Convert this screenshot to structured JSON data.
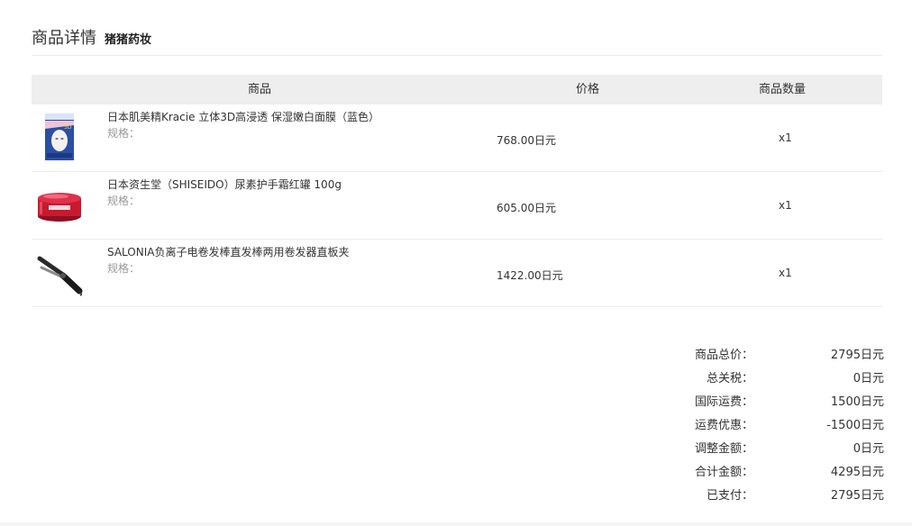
{
  "header": {
    "title": "商品详情",
    "shop_name": "猪猪药妆"
  },
  "table": {
    "columns": {
      "product": "商品",
      "price": "价格",
      "quantity": "商品数量"
    },
    "rows": [
      {
        "name": "日本肌美精Kracie 立体3D高浸透 保湿嫩白面膜（蓝色）",
        "spec_label": "规格：",
        "price": "768.00日元",
        "quantity": "x1",
        "thumbnail_icon": "face-mask-product-image"
      },
      {
        "name": "日本资生堂（SHISEIDO）尿素护手霜红罐 100g",
        "spec_label": "规格：",
        "price": "605.00日元",
        "quantity": "x1",
        "thumbnail_icon": "hand-cream-jar-product-image"
      },
      {
        "name": "SALONIA负离子电卷发棒直发棒两用卷发器直板夹",
        "spec_label": "规格：",
        "price": "1422.00日元",
        "quantity": "x1",
        "thumbnail_icon": "curling-iron-product-image"
      }
    ]
  },
  "summary": [
    {
      "label": "商品总价：",
      "value": "2795日元"
    },
    {
      "label": "总关税：",
      "value": "0日元"
    },
    {
      "label": "国际运费：",
      "value": "1500日元"
    },
    {
      "label": "运费优惠：",
      "value": "-1500日元"
    },
    {
      "label": "调整金额：",
      "value": "0日元"
    },
    {
      "label": "合计金额：",
      "value": "4295日元"
    },
    {
      "label": "已支付：",
      "value": "2795日元"
    }
  ]
}
